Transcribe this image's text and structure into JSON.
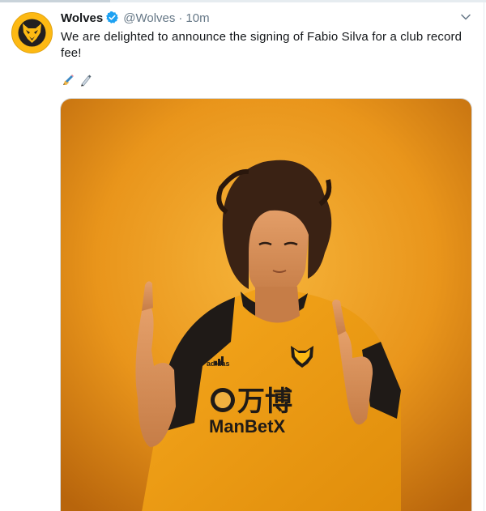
{
  "tweet": {
    "display_name": "Wolves",
    "handle": "@Wolves",
    "separator": "·",
    "time": "10m",
    "text": "We are delighted to announce the signing of Fabio Silva for a club record fee!",
    "emojis": [
      "writing-hand-emoji",
      "pen-emoji"
    ],
    "verified_icon": "verified-badge-icon",
    "menu_icon": "chevron-down-icon",
    "avatar_icon": "wolf-crest-icon"
  },
  "media": {
    "shirt_sponsor_cn": "万博",
    "shirt_sponsor": "ManBetX",
    "kit_brand": "adidas"
  },
  "colors": {
    "brand_gold": "#fdb913",
    "background_orange": "#f0a020",
    "verified_blue": "#1da1f2",
    "secondary_text": "#657786"
  }
}
